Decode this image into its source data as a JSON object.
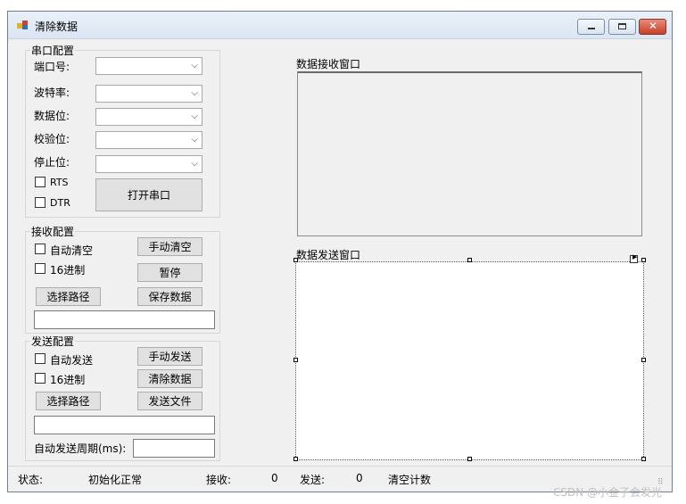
{
  "window": {
    "title": "清除数据"
  },
  "serial_config": {
    "group_title": "串口配置",
    "fields": [
      {
        "label": "端口号:",
        "value": ""
      },
      {
        "label": "波特率:",
        "value": ""
      },
      {
        "label": "数据位:",
        "value": ""
      },
      {
        "label": "校验位:",
        "value": ""
      },
      {
        "label": "停止位:",
        "value": ""
      }
    ],
    "rts_label": "RTS",
    "dtr_label": "DTR",
    "open_button": "打开串口"
  },
  "receive_config": {
    "group_title": "接收配置",
    "auto_clear_label": "自动清空",
    "hex_label": "16进制",
    "manual_clear_button": "手动清空",
    "pause_button": "暂停",
    "choose_path_button": "选择路径",
    "save_data_button": "保存数据",
    "path_value": ""
  },
  "send_config": {
    "group_title": "发送配置",
    "auto_send_label": "自动发送",
    "hex_label": "16进制",
    "manual_send_button": "手动发送",
    "clear_data_button": "清除数据",
    "choose_path_button": "选择路径",
    "send_file_button": "发送文件",
    "path_value": "",
    "period_label": "自动发送周期(ms):",
    "period_value": ""
  },
  "receive_window": {
    "label": "数据接收窗口"
  },
  "send_window": {
    "label": "数据发送窗口"
  },
  "status_bar": {
    "status_label": "状态:",
    "status_value": "初始化正常",
    "recv_label": "接收:",
    "recv_count": "0",
    "send_label": "发送:",
    "send_count": "0",
    "clear_count": "清空计数"
  },
  "watermark": "CSDN @小金子会发光"
}
